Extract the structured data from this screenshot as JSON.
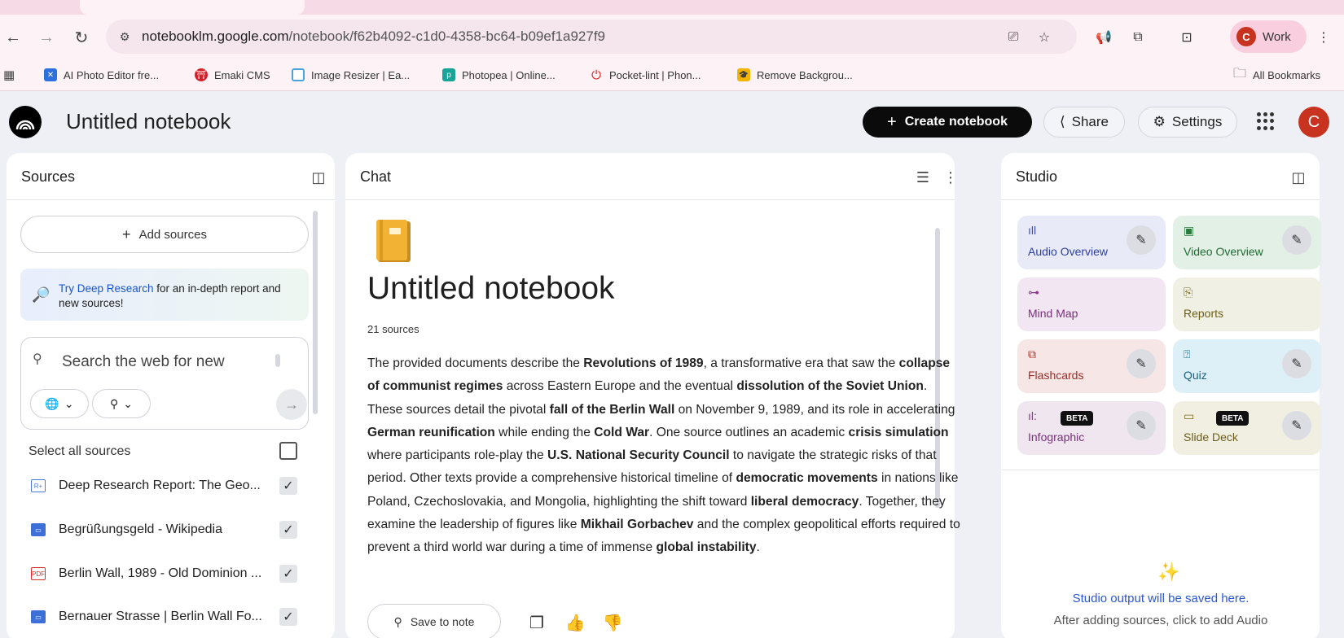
{
  "browser": {
    "url_domain": "notebooklm.google.com",
    "url_path": "/notebook/f62b4092-c1d0-4358-bc64-b09ef1a927f9",
    "profile_initial": "C",
    "profile_label": "Work",
    "bookmarks": [
      {
        "label": "AI Photo Editor fre...",
        "icon": "ai-photo-editor-icon",
        "color": "#2d6fdc"
      },
      {
        "label": "Emaki CMS",
        "icon": "emaki-icon",
        "color": "#d3202a"
      },
      {
        "label": "Image Resizer | Ea...",
        "icon": "image-resizer-icon",
        "color": "#4aa3df"
      },
      {
        "label": "Photopea | Online...",
        "icon": "photopea-icon",
        "color": "#18a497"
      },
      {
        "label": "Pocket-lint | Phon...",
        "icon": "power-icon",
        "color": "#e0221c"
      },
      {
        "label": "Remove Backgrou...",
        "icon": "remove-bg-icon",
        "color": "#f5b400"
      }
    ],
    "all_bookmarks_label": "All Bookmarks"
  },
  "header": {
    "title": "Untitled notebook",
    "create_label": "Create notebook",
    "share_label": "Share",
    "settings_label": "Settings",
    "user_initial": "C"
  },
  "sources": {
    "title": "Sources",
    "add_label": "Add sources",
    "deep_research_link": "Try Deep Research",
    "deep_research_text": " for an in-depth report and new sources!",
    "search_placeholder": "Search the web for new",
    "select_all_label": "Select all sources",
    "items": [
      {
        "name": "Deep Research Report: The Geo...",
        "icon": "deep-research-icon",
        "checked": true
      },
      {
        "name": "Begrüßungsgeld - Wikipedia",
        "icon": "web-page-icon",
        "checked": true
      },
      {
        "name": "Berlin Wall, 1989 - Old Dominion ...",
        "icon": "pdf-icon",
        "checked": true
      },
      {
        "name": "Bernauer Strasse | Berlin Wall Fo...",
        "icon": "web-page-icon",
        "checked": true
      }
    ]
  },
  "chat": {
    "title": "Chat",
    "notebook_title": "Untitled notebook",
    "source_count": "21 sources",
    "save_label": "Save to note"
  },
  "studio": {
    "title": "Studio",
    "tiles": {
      "audio": "Audio Overview",
      "video": "Video Overview",
      "mindmap": "Mind Map",
      "reports": "Reports",
      "flashcards": "Flashcards",
      "quiz": "Quiz",
      "infographic": "Infographic",
      "slidedeck": "Slide Deck",
      "beta_label": "BETA"
    },
    "empty_title": "Studio output will be saved here.",
    "empty_sub": "After adding sources, click to add Audio"
  },
  "colors": {
    "accent": "#2b57d6",
    "audio_bg": "#e9eaf7",
    "video_bg": "#e3f0e6",
    "mindmap_bg": "#f1e6f1",
    "reports_bg": "#f0f0e4",
    "flashcards_bg": "#f6e6e6",
    "quiz_bg": "#def0f7",
    "infographic_bg": "#efe6f0",
    "slidedeck_bg": "#f1efe2"
  }
}
